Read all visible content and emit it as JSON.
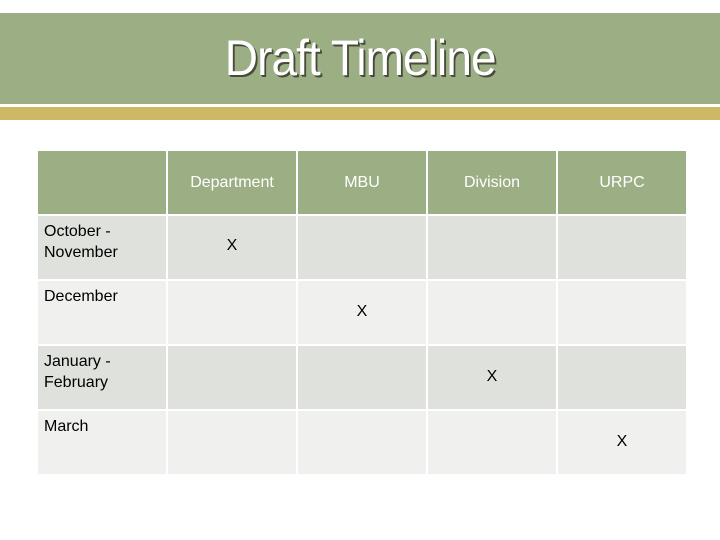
{
  "slide": {
    "title": "Draft Timeline",
    "colors": {
      "banner": "#9caf84",
      "stripe": "#cdb866",
      "row_dark": "#dfe2dc",
      "row_light": "#f0f1ee"
    }
  },
  "table": {
    "headers": [
      "",
      "Department",
      "MBU",
      "Division",
      "URPC"
    ],
    "rows": [
      {
        "period": "October - November",
        "cells": [
          "X",
          "",
          "",
          ""
        ]
      },
      {
        "period": "December",
        "cells": [
          "",
          "X",
          "",
          ""
        ]
      },
      {
        "period": "January - February",
        "cells": [
          "",
          "",
          "X",
          ""
        ]
      },
      {
        "period": "March",
        "cells": [
          "",
          "",
          "",
          "X"
        ]
      }
    ]
  }
}
